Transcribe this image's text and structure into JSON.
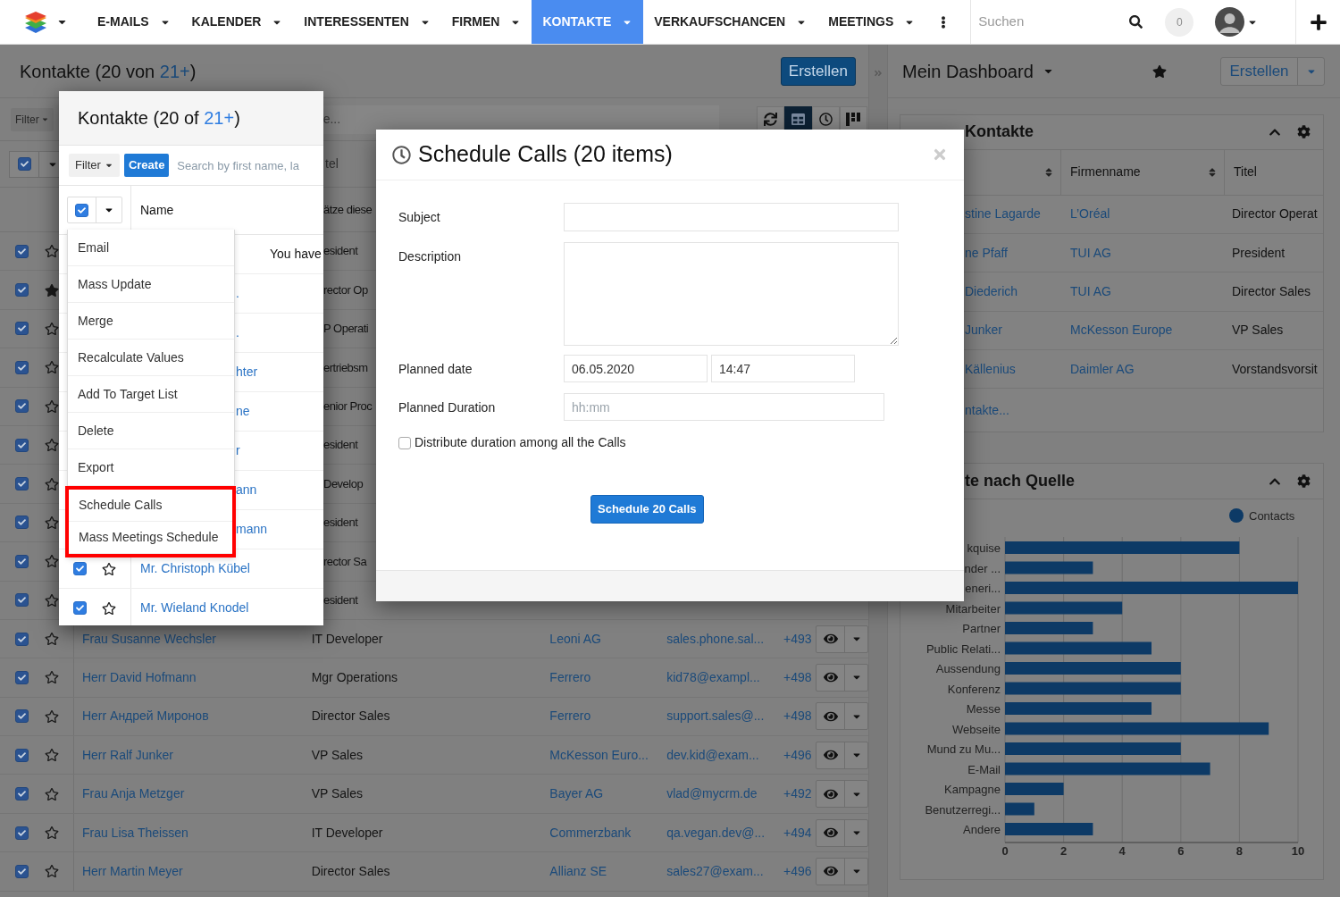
{
  "nav": {
    "items": [
      {
        "label": "E-MAILS",
        "selected": false
      },
      {
        "label": "KALENDER",
        "selected": false
      },
      {
        "label": "INTERESSENTEN",
        "selected": false
      },
      {
        "label": "FIRMEN",
        "selected": false
      },
      {
        "label": "KONTAKTE",
        "selected": true
      },
      {
        "label": "VERKAUFSCHANCEN",
        "selected": false
      },
      {
        "label": "MEETINGS",
        "selected": false
      }
    ],
    "search": {
      "placeholder": "Suchen"
    },
    "notifications": "0"
  },
  "main": {
    "title_prefix": "Kontakte (20 von ",
    "total_link": "21+",
    "title_suffix": ")",
    "create_button": "Erstellen",
    "filter_button": "Filter",
    "search_fragment": "e...",
    "select_all": {
      "checked": true
    },
    "select_fragment": "tel",
    "notice_fragment": "ätze diese",
    "view_buttons": [
      {
        "kind": "refresh",
        "selected": false
      },
      {
        "kind": "table",
        "selected": true
      },
      {
        "kind": "timeline",
        "selected": false
      },
      {
        "kind": "kanban",
        "selected": false
      }
    ],
    "rows": [
      {
        "kind": "partial",
        "checked": true,
        "starred": false,
        "title": "esident"
      },
      {
        "kind": "partial",
        "checked": true,
        "starred": true,
        "title": "rector Op"
      },
      {
        "kind": "partial",
        "checked": true,
        "starred": false,
        "title": "P Operati"
      },
      {
        "kind": "partial",
        "checked": true,
        "starred": false,
        "title": "ertriebsm"
      },
      {
        "kind": "partial",
        "checked": true,
        "starred": false,
        "title": "enior Proc"
      },
      {
        "kind": "partial",
        "checked": true,
        "starred": false,
        "title": "esident"
      },
      {
        "kind": "partial",
        "checked": true,
        "starred": false,
        "title": "Develop"
      },
      {
        "kind": "partial",
        "checked": true,
        "starred": false,
        "title": "esident"
      },
      {
        "kind": "partial",
        "checked": true,
        "starred": false,
        "title": "rector Sa"
      },
      {
        "kind": "partial",
        "checked": true,
        "starred": false,
        "title": "esident"
      },
      {
        "kind": "full",
        "checked": true,
        "starred": false,
        "name": "Frau Susanne Wechsler",
        "title": "IT Developer",
        "company": "Leoni AG",
        "email": "sales.phone.sal...",
        "phone": "+493"
      },
      {
        "kind": "full",
        "checked": true,
        "starred": false,
        "name": "Herr David Hofmann",
        "title": "Mgr Operations",
        "company": "Ferrero",
        "email": "kid78@exampl...",
        "phone": "+498"
      },
      {
        "kind": "full",
        "checked": true,
        "starred": false,
        "name": "Herr Андрей Миронов",
        "title": "Director Sales",
        "company": "Ferrero",
        "email": "support.sales@...",
        "phone": "+498"
      },
      {
        "kind": "full",
        "checked": true,
        "starred": false,
        "name": "Herr Ralf Junker",
        "title": "VP Sales",
        "company": "McKesson Euro...",
        "email": "dev.kid@exam...",
        "phone": "+496"
      },
      {
        "kind": "full",
        "checked": true,
        "starred": false,
        "name": "Frau Anja Metzger",
        "title": "VP Sales",
        "company": "Bayer AG",
        "email": "vlad@mycrm.de",
        "phone": "+492"
      },
      {
        "kind": "full",
        "checked": true,
        "starred": false,
        "name": "Frau Lisa Theissen",
        "title": "IT Developer",
        "company": "Commerzbank",
        "email": "qa.vegan.dev@...",
        "phone": "+494"
      },
      {
        "kind": "full",
        "checked": true,
        "starred": false,
        "name": "Herr Martin Meyer",
        "title": "Director Sales",
        "company": "Allianz SE",
        "email": "sales27@exam...",
        "phone": "+496"
      }
    ]
  },
  "popup": {
    "title_prefix": "Kontakte (20 of ",
    "total_link": "21+",
    "title_suffix": ")",
    "filter_button": "Filter",
    "create_button": "Create",
    "search": {
      "placeholder": "Search by first name, la"
    },
    "select_all": {
      "checked": true
    },
    "column": "Name",
    "menu": [
      {
        "label": "Email",
        "highlighted": false
      },
      {
        "label": "Mass Update",
        "highlighted": false
      },
      {
        "label": "Merge",
        "highlighted": false
      },
      {
        "label": "Recalculate Values",
        "highlighted": false
      },
      {
        "label": "Add To Target List",
        "highlighted": false
      },
      {
        "label": "Delete",
        "highlighted": false
      },
      {
        "label": "Export",
        "highlighted": false
      },
      {
        "label": "Schedule Calls",
        "highlighted": true
      },
      {
        "label": "Mass Meetings Schedule",
        "highlighted": true
      }
    ],
    "rows": [
      {
        "kind": "notice",
        "text": "You have"
      },
      {
        "kind": "fragment",
        "text": "."
      },
      {
        "kind": "fragment",
        "text": "."
      },
      {
        "kind": "fragment",
        "text": "hter"
      },
      {
        "kind": "fragment",
        "text": "ne"
      },
      {
        "kind": "fragment",
        "text": "r"
      },
      {
        "kind": "fragment",
        "text": "ann"
      },
      {
        "kind": "fragment",
        "text": "mann"
      },
      {
        "kind": "full",
        "checked": true,
        "starred": false,
        "name": "Mr. Christoph Kübel"
      },
      {
        "kind": "full",
        "checked": true,
        "starred": false,
        "name": "Mr. Wieland Knodel"
      }
    ]
  },
  "modal": {
    "title": "Schedule Calls (20 items)",
    "fields": [
      {
        "kind": "text",
        "label": "Subject"
      },
      {
        "kind": "textarea",
        "label": "Description"
      },
      {
        "kind": "datetime",
        "label": "Planned date",
        "date": "06.05.2020",
        "time": "14:47"
      },
      {
        "kind": "duration",
        "label": "Planned Duration",
        "placeholder": "hh:mm"
      }
    ],
    "distribute": {
      "label": "Distribute duration among all the Calls",
      "checked": false
    },
    "submit_button": "Schedule 20 Calls"
  },
  "dashboard": {
    "title": "Mein Dashboard",
    "create_button": "Erstellen",
    "contacts_panel": {
      "title": "Kontakte",
      "columns": [
        "Firmenname",
        "Titel"
      ],
      "rows": [
        {
          "name": "stine Lagarde",
          "company": "L’Oréal",
          "title": "Director Operat"
        },
        {
          "name": "ne Pfaff",
          "company": "TUI AG",
          "title": "President"
        },
        {
          "name": "Diederich",
          "company": "TUI AG",
          "title": "Director Sales"
        },
        {
          "name": "Junker",
          "company": "McKesson Europe",
          "title": "VP Sales"
        },
        {
          "name": "Källenius",
          "company": "Daimler AG",
          "title": "Vorstandsvorsit"
        }
      ],
      "more_link": "ntakte..."
    },
    "chart_panel": {
      "title": "te nach Quelle",
      "chart_data": {
        "type": "bar",
        "orientation": "horizontal",
        "categories": [
          "kquise",
          "nder ...",
          "eneri...",
          "Mitarbeiter",
          "Partner",
          "Public Relati...",
          "Aussendung",
          "Konferenz",
          "Messe",
          "Webseite",
          "Mund zu Mu...",
          "E-Mail",
          "Kampagne",
          "Benutzerregi...",
          "Andere"
        ],
        "series": [
          {
            "name": "Contacts",
            "color": "#0d3a66",
            "values": [
              8,
              3,
              10,
              4,
              3,
              5,
              6,
              6,
              5,
              9,
              6,
              7,
              2,
              1,
              3
            ]
          }
        ],
        "xlim": [
          0,
          10
        ],
        "xticks": [
          0,
          2,
          4,
          6,
          8,
          10
        ],
        "grid": true
      }
    }
  }
}
